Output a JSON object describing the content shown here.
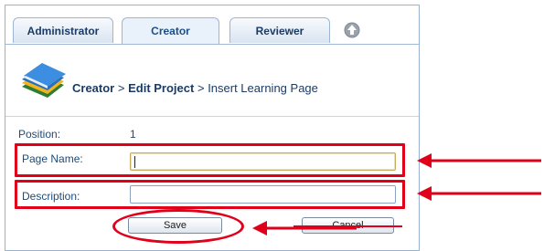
{
  "tabs": [
    {
      "label": "Administrator",
      "active": false
    },
    {
      "label": "Creator",
      "active": true
    },
    {
      "label": "Reviewer",
      "active": false
    }
  ],
  "icons": {
    "up": "up-arrow-icon",
    "logo": "book-stack-icon"
  },
  "breadcrumb": {
    "part1": "Creator",
    "sep1": ">",
    "part2": "Edit Project",
    "sep2": ">",
    "part3": "Insert Learning Page"
  },
  "form": {
    "position_label": "Position:",
    "position_value": "1",
    "page_name_label": "Page Name:",
    "page_name_value": "",
    "description_label": "Description:",
    "description_value": ""
  },
  "buttons": {
    "save": "Save",
    "cancel": "Cancel"
  },
  "colors": {
    "highlight": "#e0001a",
    "tab_border": "#9cb6d3",
    "text": "#1f4a78"
  }
}
